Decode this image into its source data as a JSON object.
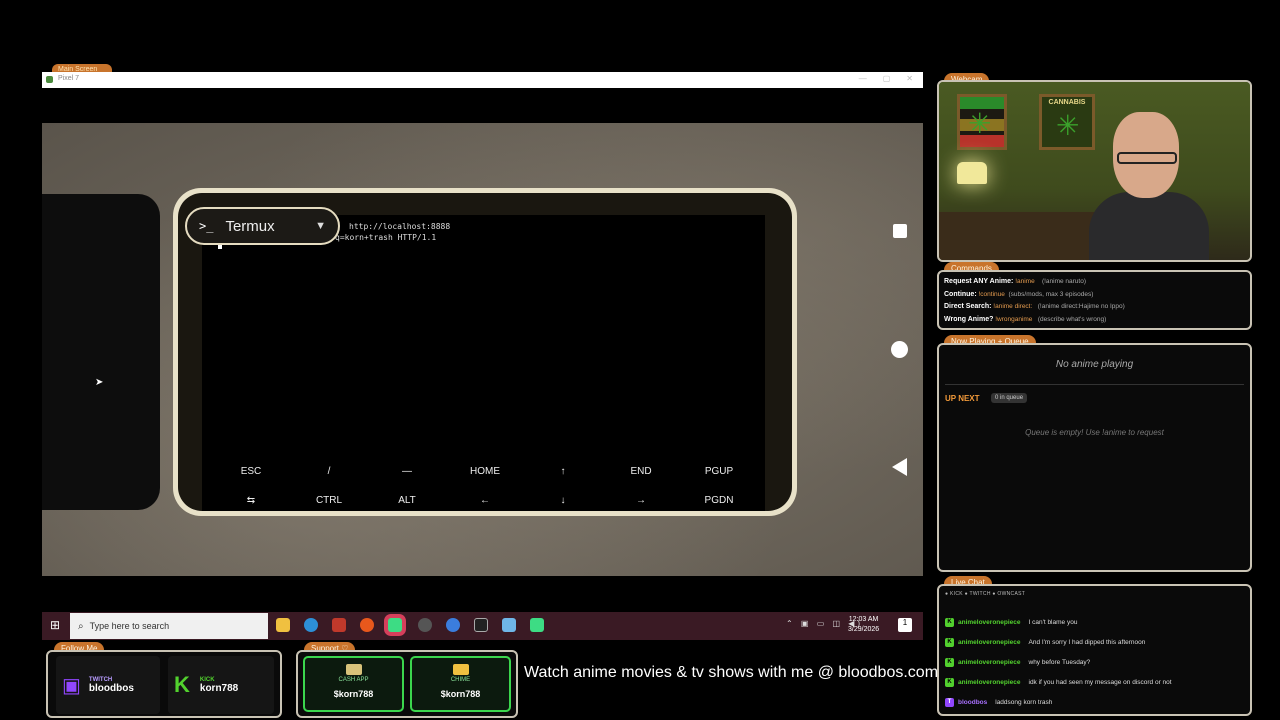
{
  "main_screen": {
    "tab_label": "Main Screen",
    "window_title": "Pixel 7"
  },
  "termux": {
    "app_name": "Termux",
    "lines": [
      "http://localhost:8888",
      "q=korn+trash HTTP/1.1"
    ],
    "extra_keys_row1": [
      "ESC",
      "/",
      "—",
      "HOME",
      "↑",
      "END",
      "PGUP"
    ],
    "extra_keys_row2": [
      "⇆",
      "CTRL",
      "ALT",
      "←",
      "↓",
      "→",
      "PGDN"
    ]
  },
  "taskbar": {
    "search_placeholder": "Type here to search",
    "time": "12:03 AM",
    "date": "3/29/2026",
    "notif_count": "1"
  },
  "webcam": {
    "label": "Webcam",
    "poster_text": "CANNABIS"
  },
  "commands": {
    "label": "Commands",
    "items": [
      {
        "title": "Request ANY Anime:",
        "cmd": "!anime",
        "hint": "(!anime naruto)"
      },
      {
        "title": "Continue:",
        "cmd": "!continue",
        "hint": "(subs/mods, max 3 episodes)"
      },
      {
        "title": "Direct Search:",
        "cmd": "!anime direct:",
        "hint": "(!anime direct:Hajime no Ippo)"
      },
      {
        "title": "Wrong Anime?",
        "cmd": "!wronganime",
        "hint": "(describe what's wrong)"
      }
    ]
  },
  "now_playing": {
    "label": "Now Playing + Queue",
    "none_text": "No anime playing",
    "up_next": "UP NEXT",
    "queue_count": "0 in queue",
    "queue_empty": "Queue is empty! Use !anime to request"
  },
  "chat": {
    "label": "Live Chat",
    "platforms": "● KICK  ● TWITCH  ● OWNCAST",
    "messages": [
      {
        "user": "animeloveronepiece",
        "text": "I can't blame you",
        "platform": "kick"
      },
      {
        "user": "animeloveronepiece",
        "text": "And I'm sorry I had dipped this afternoon",
        "platform": "kick"
      },
      {
        "user": "animeloveronepiece",
        "text": "why before Tuesday?",
        "platform": "kick"
      },
      {
        "user": "animeloveronepiece",
        "text": "idk if you had seen my message on discord or not",
        "platform": "kick"
      },
      {
        "user": "bloodbos",
        "text": "laddsong korn trash",
        "platform": "twitch"
      }
    ]
  },
  "follow": {
    "label": "Follow Me",
    "twitch": {
      "platform": "TWITCH",
      "handle": "bloodbos"
    },
    "kick": {
      "platform": "KICK",
      "handle": "korn788"
    }
  },
  "support": {
    "label": "Support ♡",
    "cashapp": {
      "platform": "CASH APP",
      "handle": "$korn788"
    },
    "chime": {
      "platform": "CHIME",
      "handle": "$korn788"
    }
  },
  "ticker": "Watch anime movies & tv shows with me @ bloodbos.com",
  "colors": {
    "accent": "#c8742c",
    "kick_green": "#52d12e",
    "twitch_purple": "#9146ff",
    "cash_green": "#3bd64d"
  }
}
